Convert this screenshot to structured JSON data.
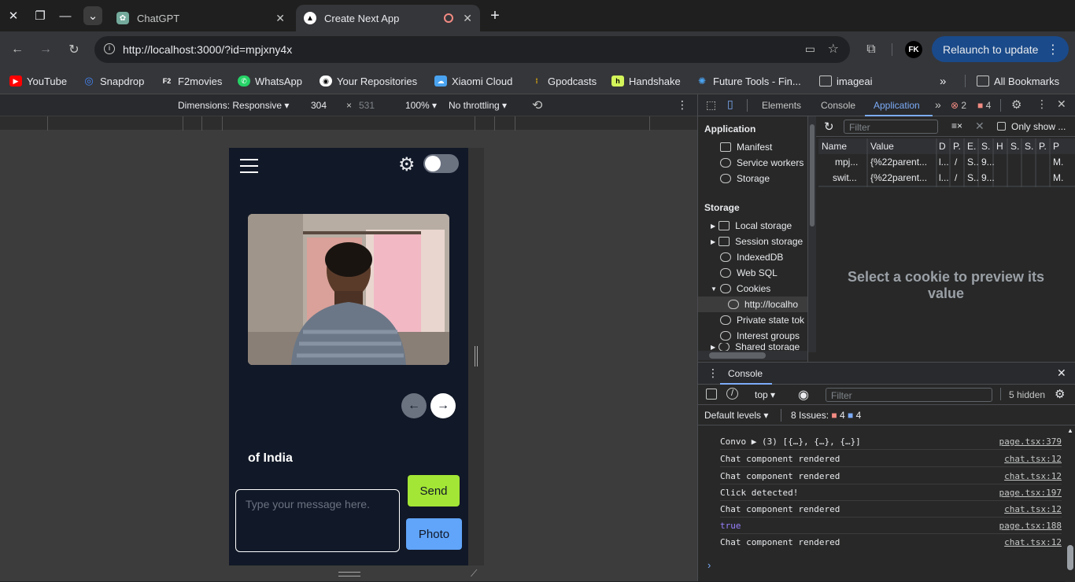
{
  "tabs": [
    {
      "title": "ChatGPT",
      "active": false
    },
    {
      "title": "Create Next App",
      "active": true
    }
  ],
  "toolbar": {
    "url": "http://localhost:3000/?id=mpjxny4x",
    "relaunch_label": "Relaunch to update",
    "profile_initials": "FK"
  },
  "bookmarks": [
    {
      "label": "YouTube",
      "color": "#ff0000"
    },
    {
      "label": "Snapdrop",
      "color": "#4285f4"
    },
    {
      "label": "F2movies",
      "color": "#ffffff"
    },
    {
      "label": "WhatsApp",
      "color": "#25d366"
    },
    {
      "label": "Your Repositories",
      "color": "#ffffff"
    },
    {
      "label": "Xiaomi Cloud",
      "color": "#4aa3f0"
    },
    {
      "label": "Gpodcasts",
      "color": "#fbbc04"
    },
    {
      "label": "Handshake",
      "color": "#d4f55a"
    },
    {
      "label": "Future Tools - Fin...",
      "color": "#4aa3f0"
    },
    {
      "label": "imageai",
      "color": "#c4c7c5"
    }
  ],
  "all_bookmarks": "All Bookmarks",
  "device_toolbar": {
    "dimensions": "Dimensions: Responsive",
    "width": "304",
    "times": "×",
    "height": "531",
    "zoom": "100%",
    "throttling": "No throttling"
  },
  "app": {
    "message_text": "of India",
    "input_placeholder": "Type your message here.",
    "send_label": "Send",
    "photo_label": "Photo",
    "prev_arrow": "←",
    "next_arrow": "→"
  },
  "devtools": {
    "tabs": [
      "Elements",
      "Console",
      "Application"
    ],
    "errors": "2",
    "warnings": "4",
    "application_head": "Application",
    "application_items": [
      "Manifest",
      "Service workers",
      "Storage"
    ],
    "storage_head": "Storage",
    "storage_items": [
      "Local storage",
      "Session storage",
      "IndexedDB",
      "Web SQL",
      "Cookies",
      "http://localho",
      "Private state tok",
      "Interest groups",
      "Shared storage"
    ],
    "filter_placeholder": "Filter",
    "only_show": "Only show ...",
    "columns": [
      "Name",
      "Value",
      "D",
      "P.",
      "E.",
      "S.",
      "H",
      "S.",
      "S.",
      "P.",
      "P"
    ],
    "rows": [
      [
        "mpj...",
        "{%22parent...",
        "l...",
        "/",
        "S..",
        "9...",
        "",
        "",
        "",
        "",
        "M."
      ],
      [
        "swit...",
        "{%22parent...",
        "l...",
        "/",
        "S..",
        "9...",
        "",
        "",
        "",
        "",
        "M."
      ]
    ],
    "preview_text": "Select a cookie to preview its value"
  },
  "console": {
    "tab_label": "Console",
    "context": "top",
    "filter_placeholder": "Filter",
    "hidden": "5 hidden",
    "levels": "Default levels",
    "issues_label": "8 Issues:",
    "issues_errors": "4",
    "issues_info": "4",
    "logs": [
      {
        "text": "Convo ▶ (3) [{…}, {…}, {…}]",
        "src": "page.tsx:379",
        "color": "#e8eaed"
      },
      {
        "text": "Chat component rendered",
        "src": "chat.tsx:12",
        "color": "#e8eaed"
      },
      {
        "text": "Chat component rendered",
        "src": "chat.tsx:12",
        "color": "#e8eaed"
      },
      {
        "text": "Click detected!",
        "src": "page.tsx:197",
        "color": "#e8eaed"
      },
      {
        "text": "Chat component rendered",
        "src": "chat.tsx:12",
        "color": "#e8eaed"
      },
      {
        "text": "true",
        "src": "page.tsx:188",
        "color": "#9980ff"
      },
      {
        "text": "Chat component rendered",
        "src": "chat.tsx:12",
        "color": "#e8eaed"
      }
    ]
  }
}
